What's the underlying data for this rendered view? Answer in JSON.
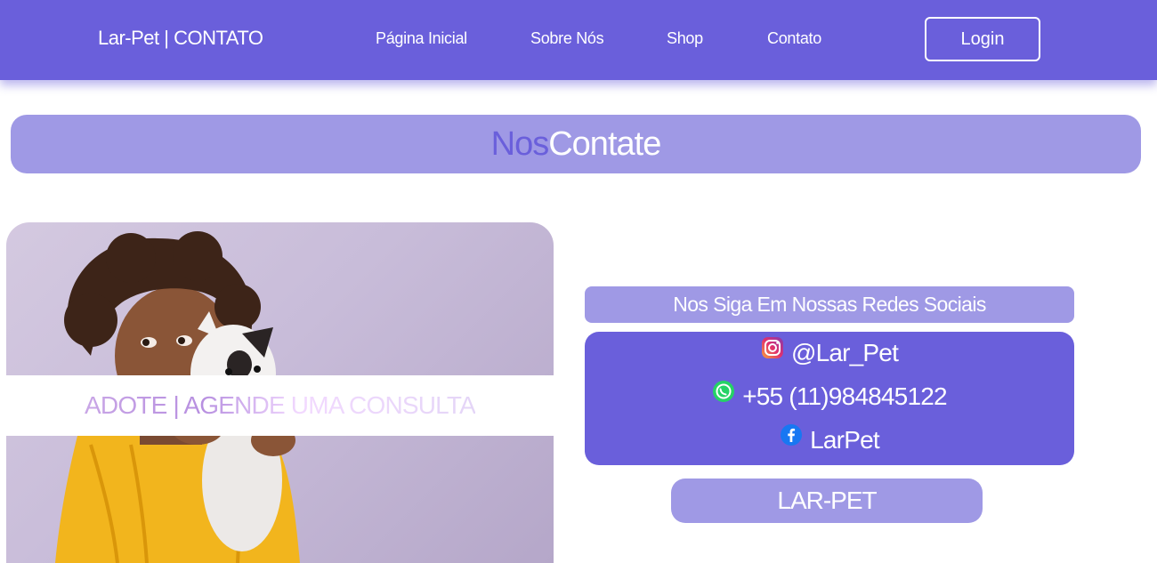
{
  "navbar": {
    "brand": "Lar-Pet | CONTATO",
    "links": [
      "Página Inicial",
      "Sobre Nós",
      "Shop",
      "Contato"
    ],
    "login_label": "Login",
    "color": "#6a5fdb"
  },
  "title": {
    "part1": "Nos",
    "part2": "Contate"
  },
  "photo": {
    "band_text": "ADOTE | AGENDE UMA CONSULTA"
  },
  "social": {
    "header": "Nos Siga Em Nossas Redes Sociais",
    "items": [
      {
        "icon": "instagram-icon",
        "text": "@Lar_Pet"
      },
      {
        "icon": "whatsapp-icon",
        "text": "+55 (11)984845122"
      },
      {
        "icon": "facebook-icon",
        "text": "LarPet"
      }
    ]
  },
  "footer_brand": "LAR-PET",
  "colors": {
    "primary": "#6a5fdb",
    "light": "#9f99e5"
  }
}
